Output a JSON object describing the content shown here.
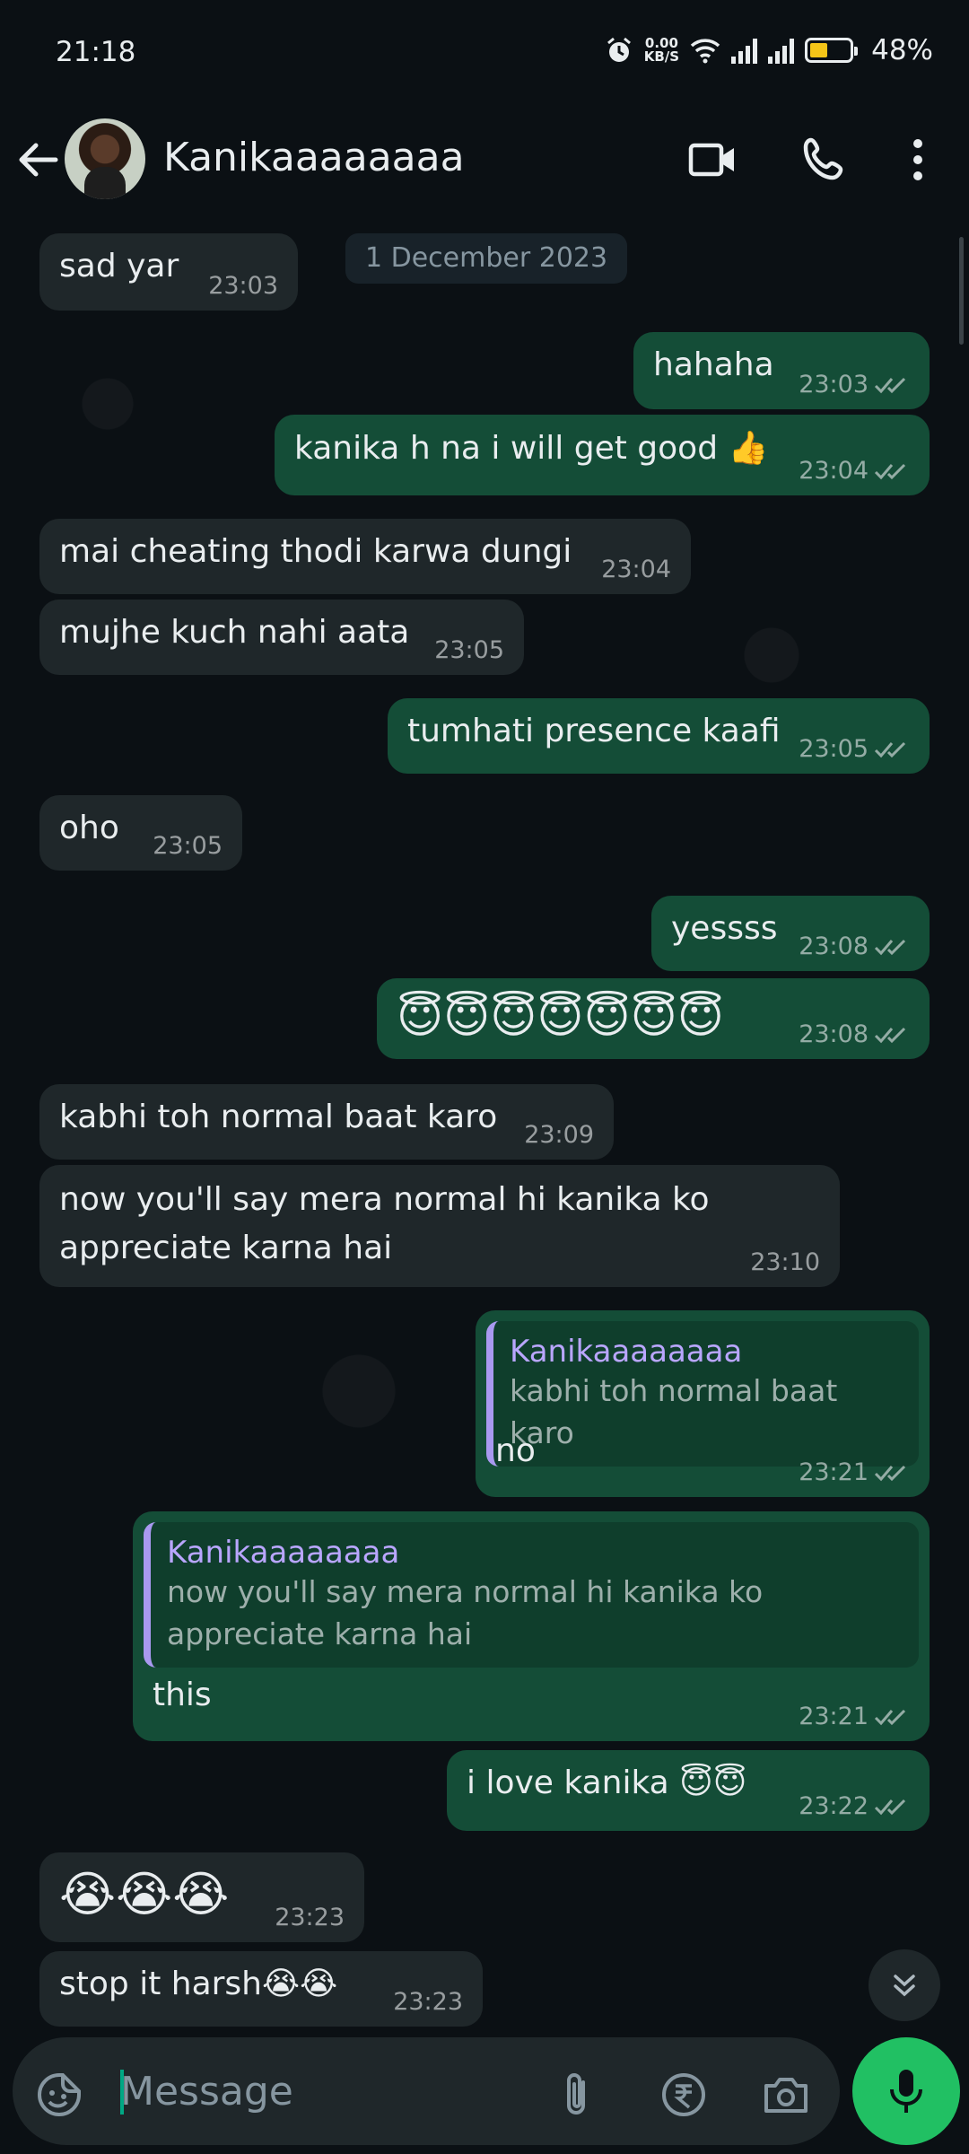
{
  "status_bar": {
    "time": "21:18",
    "speed_value": "0.00",
    "speed_unit": "KB/S",
    "battery": "48%"
  },
  "header": {
    "contact_name": "Kanikaaaaaaaa",
    "icons": [
      "back-arrow-icon",
      "video-call-icon",
      "voice-call-icon",
      "more-options-icon"
    ]
  },
  "chat": {
    "date_chip": "1 December 2023",
    "messages": [
      {
        "dir": "in",
        "text": "sad yar",
        "time": "23:03"
      },
      {
        "dir": "out",
        "text": "hahaha",
        "time": "23:03",
        "status": "read"
      },
      {
        "dir": "out",
        "text": "kanika h na i will get good 👍",
        "time": "23:04",
        "status": "read"
      },
      {
        "dir": "in",
        "text": "mai cheating thodi karwa dungi",
        "time": "23:04"
      },
      {
        "dir": "in",
        "text": "mujhe kuch nahi aata",
        "time": "23:05"
      },
      {
        "dir": "out",
        "text": "tumhati presence kaafi",
        "time": "23:05",
        "status": "read"
      },
      {
        "dir": "in",
        "text": "oho",
        "time": "23:05"
      },
      {
        "dir": "out",
        "text": "yessss",
        "time": "23:08",
        "status": "read"
      },
      {
        "dir": "out",
        "text": "😇😇😇😇😇😇😇",
        "time": "23:08",
        "status": "read"
      },
      {
        "dir": "in",
        "text": "kabhi toh normal baat karo",
        "time": "23:09"
      },
      {
        "dir": "in",
        "text_line1": "now you'll say mera normal hi kanika ko",
        "text_line2": "appreciate karna hai",
        "time": "23:10"
      },
      {
        "dir": "out",
        "quote_name": "Kanikaaaaaaaa",
        "quote_text": "kabhi toh normal baat karo",
        "text": "no",
        "time": "23:21",
        "status": "read"
      },
      {
        "dir": "out",
        "quote_name": "Kanikaaaaaaaa",
        "quote_line1": "now you'll say mera normal hi kanika ko",
        "quote_line2": "appreciate karna hai",
        "text": "this",
        "time": "23:21",
        "status": "read"
      },
      {
        "dir": "out",
        "text": "i love kanika 😇😇",
        "time": "23:22",
        "status": "read"
      },
      {
        "dir": "in",
        "text": "😭😭😭",
        "time": "23:23"
      },
      {
        "dir": "in",
        "text": "stop it harsh😭😭",
        "time": "23:23"
      }
    ]
  },
  "composer": {
    "placeholder": "Message",
    "icons": [
      "sticker-icon",
      "attach-icon",
      "rupee-payment-icon",
      "camera-icon",
      "mic-icon"
    ]
  },
  "colors": {
    "background": "#0b1014",
    "incoming_bubble": "#1f272a",
    "outgoing_bubble": "#144d37",
    "accent": "#21c063",
    "quote_bar": "#a999f0"
  }
}
